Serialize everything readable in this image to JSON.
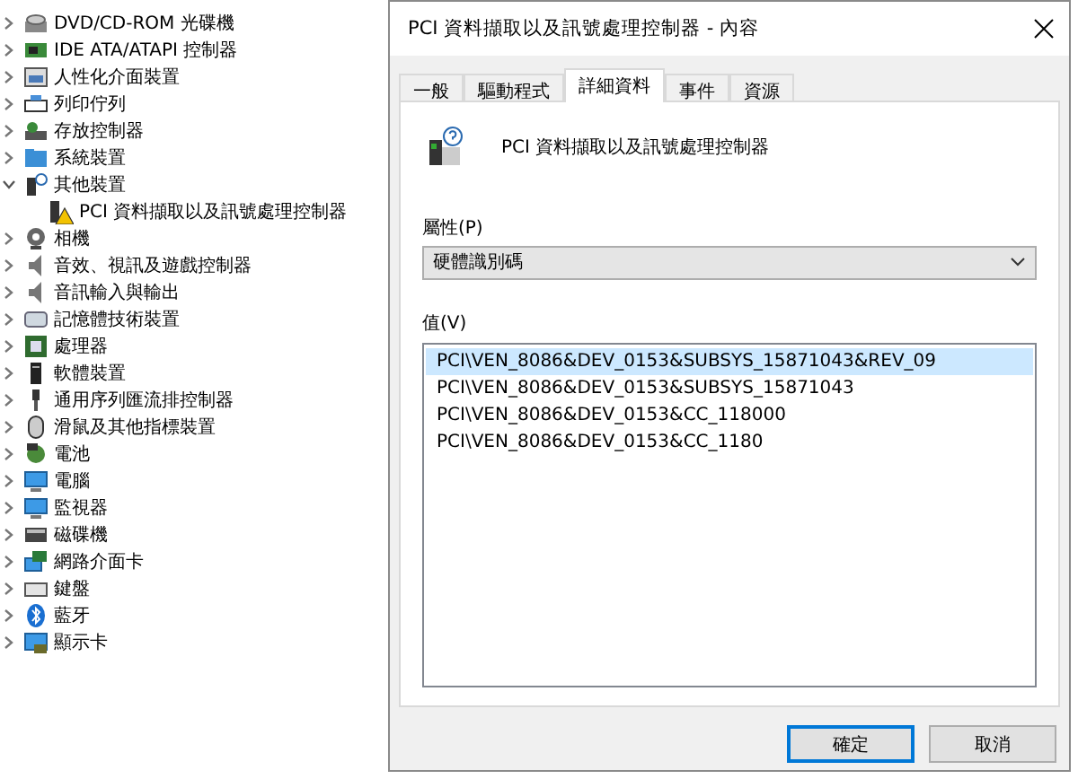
{
  "device_tree": [
    {
      "label": "DVD/CD-ROM 光碟機",
      "expanded": false
    },
    {
      "label": "IDE ATA/ATAPI 控制器",
      "expanded": false
    },
    {
      "label": "人性化介面裝置",
      "expanded": false
    },
    {
      "label": "列印佇列",
      "expanded": false
    },
    {
      "label": "存放控制器",
      "expanded": false
    },
    {
      "label": "系統裝置",
      "expanded": false
    },
    {
      "label": "其他裝置",
      "expanded": true,
      "children": [
        {
          "label": "PCI 資料擷取以及訊號處理控制器"
        }
      ]
    },
    {
      "label": "相機",
      "expanded": false
    },
    {
      "label": "音效、視訊及遊戲控制器",
      "expanded": false
    },
    {
      "label": "音訊輸入與輸出",
      "expanded": false
    },
    {
      "label": "記憶體技術裝置",
      "expanded": false
    },
    {
      "label": "處理器",
      "expanded": false
    },
    {
      "label": "軟體裝置",
      "expanded": false
    },
    {
      "label": "通用序列匯流排控制器",
      "expanded": false
    },
    {
      "label": "滑鼠及其他指標裝置",
      "expanded": false
    },
    {
      "label": "電池",
      "expanded": false
    },
    {
      "label": "電腦",
      "expanded": false
    },
    {
      "label": "監視器",
      "expanded": false
    },
    {
      "label": "磁碟機",
      "expanded": false
    },
    {
      "label": "網路介面卡",
      "expanded": false
    },
    {
      "label": "鍵盤",
      "expanded": false
    },
    {
      "label": "藍牙",
      "expanded": false
    },
    {
      "label": "顯示卡",
      "expanded": false
    }
  ],
  "dialog": {
    "title": "PCI 資料擷取以及訊號處理控制器 - 內容",
    "tabs": [
      {
        "label": "一般",
        "selected": false
      },
      {
        "label": "驅動程式",
        "selected": false
      },
      {
        "label": "詳細資料",
        "selected": true
      },
      {
        "label": "事件",
        "selected": false
      },
      {
        "label": "資源",
        "selected": false
      }
    ],
    "device_name": "PCI 資料擷取以及訊號處理控制器",
    "property_label": "屬性(P)",
    "property_value": "硬體識別碼",
    "value_label": "值(V)",
    "values": [
      {
        "text": "PCI\\VEN_8086&DEV_0153&SUBSYS_15871043&REV_09",
        "selected": true
      },
      {
        "text": "PCI\\VEN_8086&DEV_0153&SUBSYS_15871043",
        "selected": false
      },
      {
        "text": "PCI\\VEN_8086&DEV_0153&CC_118000",
        "selected": false
      },
      {
        "text": "PCI\\VEN_8086&DEV_0153&CC_1180",
        "selected": false
      }
    ],
    "buttons": [
      {
        "label": "確定",
        "kind": "default"
      },
      {
        "label": "取消",
        "kind": "normal"
      }
    ]
  }
}
